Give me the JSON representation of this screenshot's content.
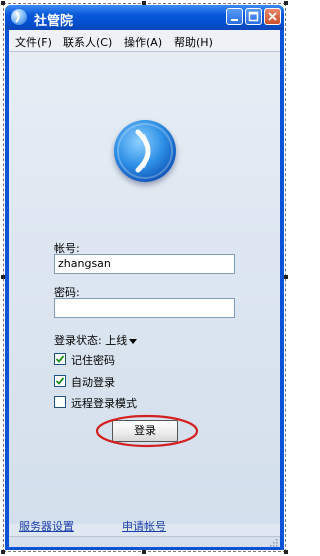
{
  "window": {
    "title": "社管院"
  },
  "menu": {
    "items": [
      {
        "label": "文件(F)"
      },
      {
        "label": "联系人(C)"
      },
      {
        "label": "操作(A)"
      },
      {
        "label": "帮助(H)"
      }
    ]
  },
  "login": {
    "account_label": "帐号:",
    "account_value": "zhangsan",
    "password_label": "密码:",
    "password_value": "",
    "status_label": "登录状态:",
    "status_value": "上线",
    "remember_password": {
      "label": "记住密码",
      "checked": true
    },
    "auto_login": {
      "label": "自动登录",
      "checked": true
    },
    "remote_login": {
      "label": "远程登录模式",
      "checked": false
    },
    "login_button": "登录"
  },
  "footer": {
    "server_settings": "服务器设置",
    "apply_account": "申请帐号"
  },
  "colors": {
    "title_bar": "#0757d9",
    "highlight_ellipse": "#d42020",
    "link": "#1a3ea8"
  }
}
